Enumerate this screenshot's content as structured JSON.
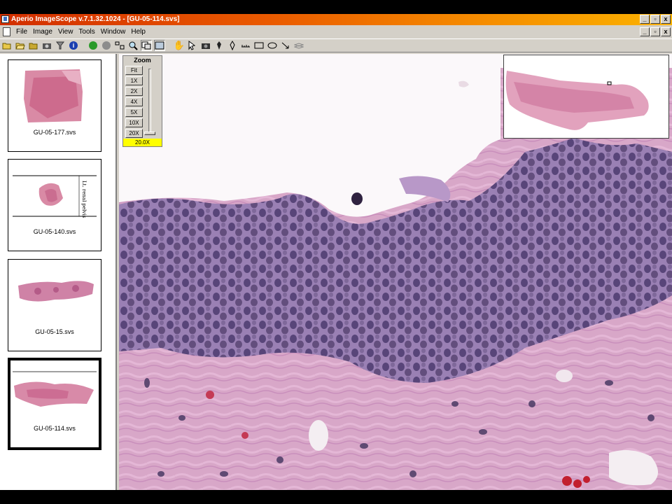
{
  "window": {
    "title": "Aperio ImageScope v.7.1.32.1024 - [GU-05-114.svs]"
  },
  "window_buttons": [
    "_",
    "▫",
    "x"
  ],
  "menu": {
    "items": [
      "File",
      "Image",
      "View",
      "Tools",
      "Window",
      "Help"
    ]
  },
  "toolbar": {
    "icons": [
      "open-icon",
      "open-folder-icon",
      "folder-icon",
      "camera-icon",
      "filter-icon",
      "info-icon",
      "back-icon",
      "forward-icon",
      "layout-icon",
      "zoom-icon",
      "copy-icon",
      "fit-icon",
      "hand-icon",
      "select-icon",
      "camera-icon",
      "pen-icon",
      "pen-tool-icon",
      "ruler-icon",
      "rectangle-icon",
      "ellipse-icon",
      "arrow-icon",
      "layers-icon"
    ]
  },
  "slides": [
    {
      "label": "GU-05-177.svs",
      "selected": false
    },
    {
      "label": "GU-05-140.svs",
      "selected": false
    },
    {
      "label": "GU-05-15.svs",
      "selected": false
    },
    {
      "label": "GU-05-114.svs",
      "selected": true
    }
  ],
  "slide_handwriting": "Lt. renal pelvis",
  "zoom": {
    "title": "Zoom",
    "buttons": [
      "Fit",
      "1X",
      "2X",
      "4X",
      "5X",
      "10X",
      "20X"
    ],
    "current": "20.0X",
    "level_fraction": 1.0
  },
  "colors": {
    "titlebar_start": "#d22f00",
    "titlebar_end": "#fbb200",
    "zoom_highlight": "#ffff00",
    "tissue_stroma": "#d7a6c9",
    "nuclei": "#4d3b6e"
  }
}
